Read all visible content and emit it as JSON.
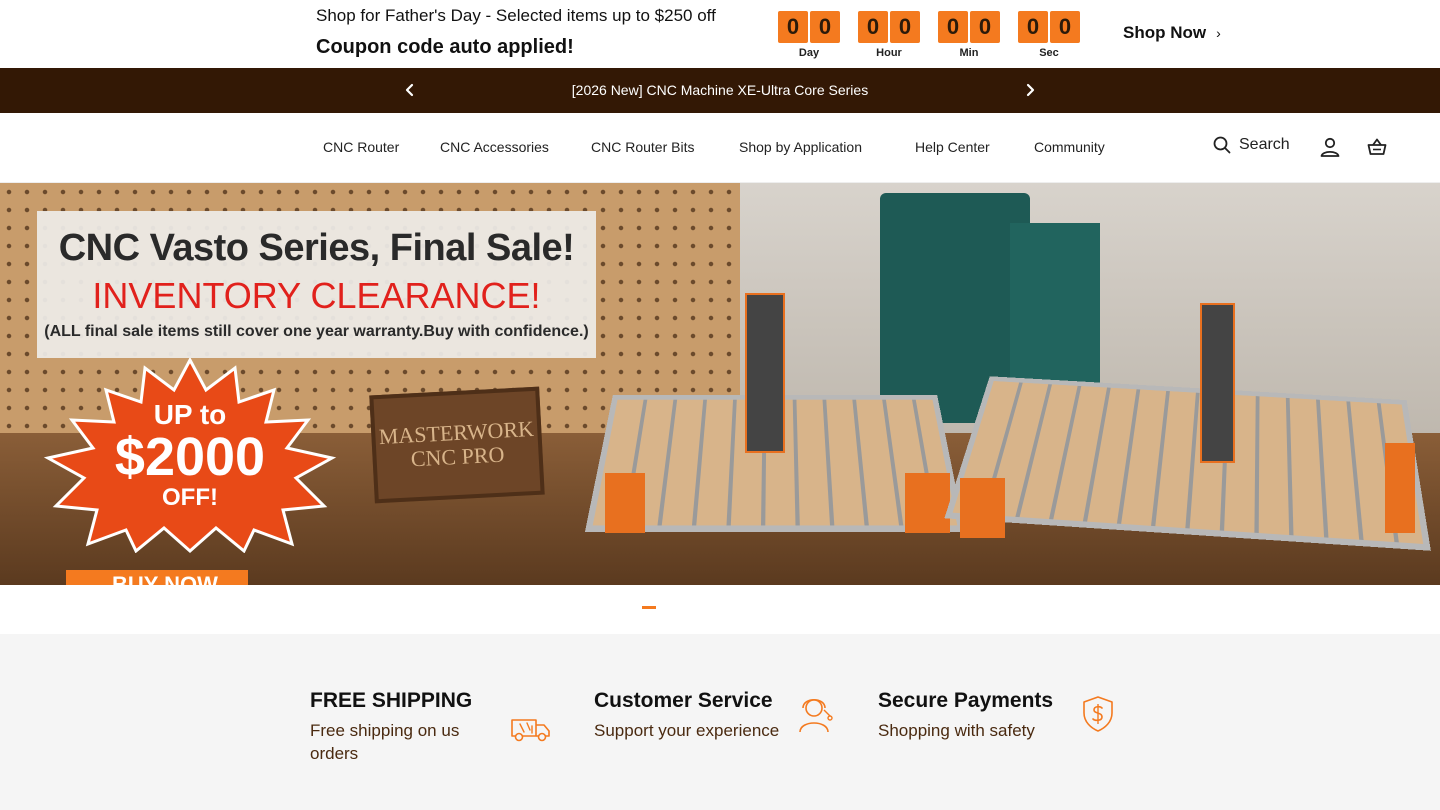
{
  "promo": {
    "line1": "Shop for Father's Day - Selected items up to $250 off",
    "line2": "Coupon code auto applied!",
    "countdown": [
      {
        "digits": [
          "0",
          "0"
        ],
        "label": "Day"
      },
      {
        "digits": [
          "0",
          "0"
        ],
        "label": "Hour"
      },
      {
        "digits": [
          "0",
          "0"
        ],
        "label": "Min"
      },
      {
        "digits": [
          "0",
          "0"
        ],
        "label": "Sec"
      }
    ],
    "cta": "Shop Now"
  },
  "announcement": {
    "text": "[2026 New] CNC Machine XE-Ultra Core Series"
  },
  "nav": {
    "items": [
      "CNC Router",
      "CNC Accessories",
      "CNC Router Bits",
      "Shop by Application",
      "Help Center",
      "Community"
    ],
    "search_label": "Search"
  },
  "hero": {
    "title": "CNC Vasto Series, Final Sale!",
    "subtitle": "INVENTORY CLEARANCE!",
    "note": "(ALL final sale items still cover one year warranty.Buy with confidence.)",
    "burst_up": "UP to",
    "burst_amount": "$2000",
    "burst_off": "OFF!",
    "plaque_line1": "MASTERWORK",
    "plaque_line2": "CNC PRO",
    "buy_now": "BUY NOW"
  },
  "features": [
    {
      "title": "FREE SHIPPING",
      "desc": "Free shipping on us orders",
      "icon": "truck-icon"
    },
    {
      "title": "Customer Service",
      "desc": "Support your experience",
      "icon": "support-agent-icon"
    },
    {
      "title": "Secure Payments",
      "desc": "Shopping with safety",
      "icon": "shield-dollar-icon"
    }
  ],
  "colors": {
    "accent": "#f47a1f",
    "announce_bg": "#331805",
    "features_bg": "#f5f5f5",
    "feature_desc": "#4a2a10"
  }
}
